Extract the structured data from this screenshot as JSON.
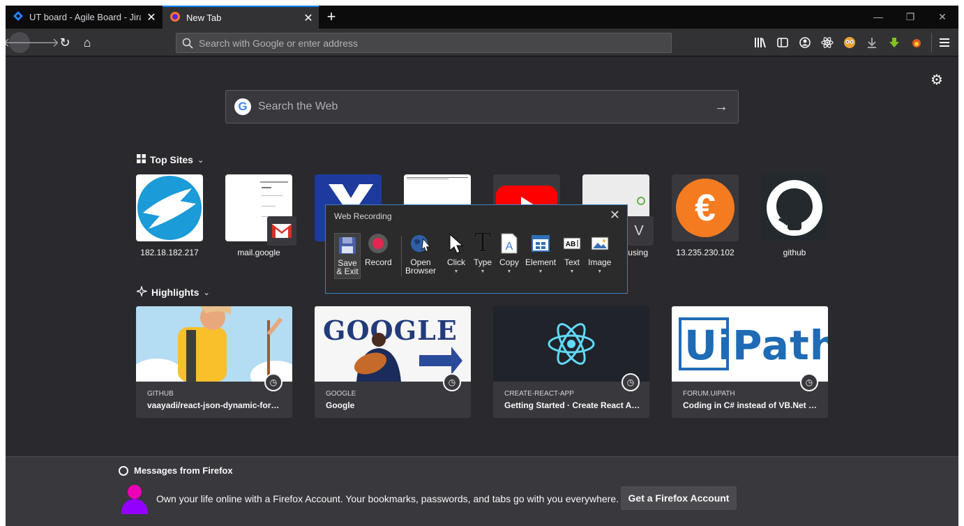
{
  "tabs": [
    {
      "title": "UT board - Agile Board - Jira",
      "icon": "jira-icon"
    },
    {
      "title": "New Tab",
      "icon": "firefox-icon"
    }
  ],
  "urlbar": {
    "placeholder": "Search with Google or enter address"
  },
  "search": {
    "placeholder": "Search the Web"
  },
  "top_sites": {
    "title": "Top Sites",
    "items": [
      {
        "label": "182.18.182.217"
      },
      {
        "label": "mail.google"
      },
      {
        "label": ""
      },
      {
        "label": ""
      },
      {
        "label": ""
      },
      {
        "label": "busing"
      },
      {
        "label": "13.235.230.102"
      },
      {
        "label": "github"
      }
    ]
  },
  "highlights": {
    "title": "Highlights",
    "items": [
      {
        "source": "GITHUB",
        "title": "vaayadi/react-json-dynamic-form..."
      },
      {
        "source": "GOOGLE",
        "title": "Google"
      },
      {
        "source": "CREATE-REACT-APP",
        "title": "Getting Started · Create React App"
      },
      {
        "source": "FORUM.UIPATH",
        "title": "Coding in C# instead of VB.Net - U..."
      }
    ]
  },
  "messages": {
    "title": "Messages from Firefox",
    "text": "Own your life online with a Firefox Account. Your bookmarks, passwords, and tabs go with you everywhere.",
    "button": "Get a Firefox Account"
  },
  "web_recording": {
    "title": "Web Recording",
    "buttons": {
      "save_line1": "Save",
      "save_line2": "& Exit",
      "record": "Record",
      "open_line1": "Open",
      "open_line2": "Browser",
      "click": "Click",
      "type": "Type",
      "copy": "Copy",
      "element": "Element",
      "text": "Text",
      "image": "Image"
    }
  },
  "misc": {
    "google_g": "G",
    "euro": "€",
    "uipath": "UiPath",
    "v": "V",
    "google_doodle": "GOOGLE"
  },
  "colors": {
    "accent": "#0a84ff",
    "background": "#2a2a2e",
    "record": "#e22850"
  }
}
